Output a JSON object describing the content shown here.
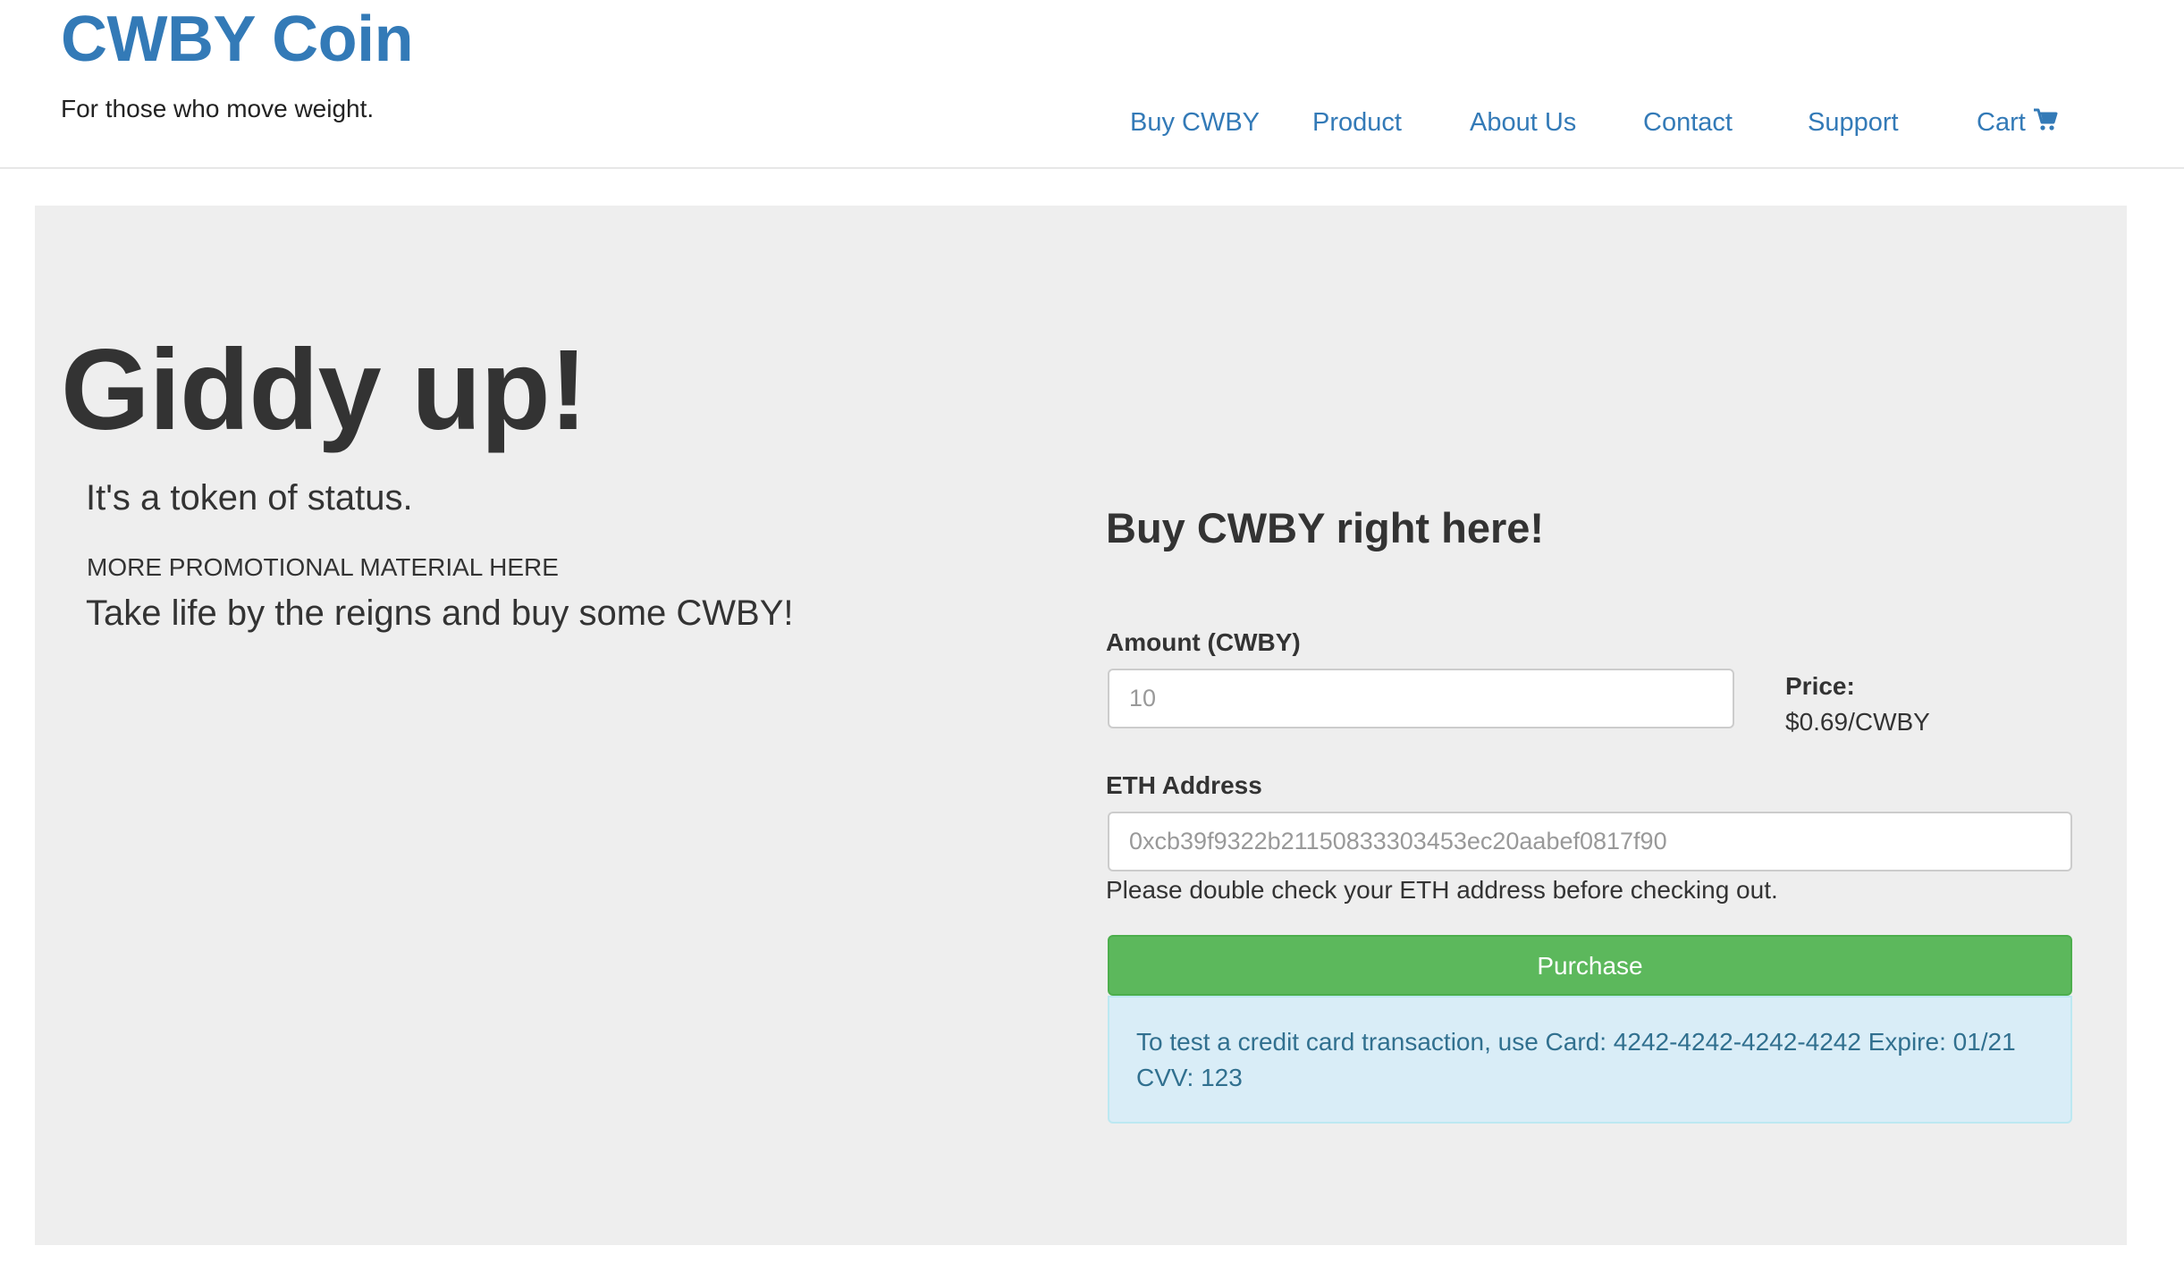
{
  "header": {
    "brand": "CWBY Coin",
    "tagline": "For those who move weight.",
    "nav": {
      "buy": "Buy CWBY",
      "product": "Product",
      "about": "About Us",
      "contact": "Contact",
      "support": "Support",
      "cart": "Cart",
      "cart_icon": "shopping-cart-icon"
    }
  },
  "hero": {
    "title": "Giddy up!",
    "subtitle": "It's a token of status.",
    "promo_caps": "MORE PROMOTIONAL MATERIAL HERE",
    "promo_line": "Take life by the reigns and buy some CWBY!"
  },
  "form": {
    "title": "Buy CWBY right here!",
    "amount_label": "Amount (CWBY)",
    "amount_placeholder": "10",
    "price_label": "Price:",
    "price_value": "$0.69/CWBY",
    "eth_label": "ETH Address",
    "eth_placeholder": "0xcb39f9322b21150833303453ec20aabef0817f90",
    "help_text": "Please double check your ETH address before checking out.",
    "purchase_label": "Purchase",
    "info_text": "To test a credit card transaction, use Card: 4242-4242-4242-4242 Expire: 01/21 CVV: 123"
  },
  "colors": {
    "link": "#337ab7",
    "jumbotron_bg": "#eeeeee",
    "button_success": "#5cb85c",
    "alert_info_bg": "#d9edf7",
    "alert_info_text": "#31708f"
  }
}
